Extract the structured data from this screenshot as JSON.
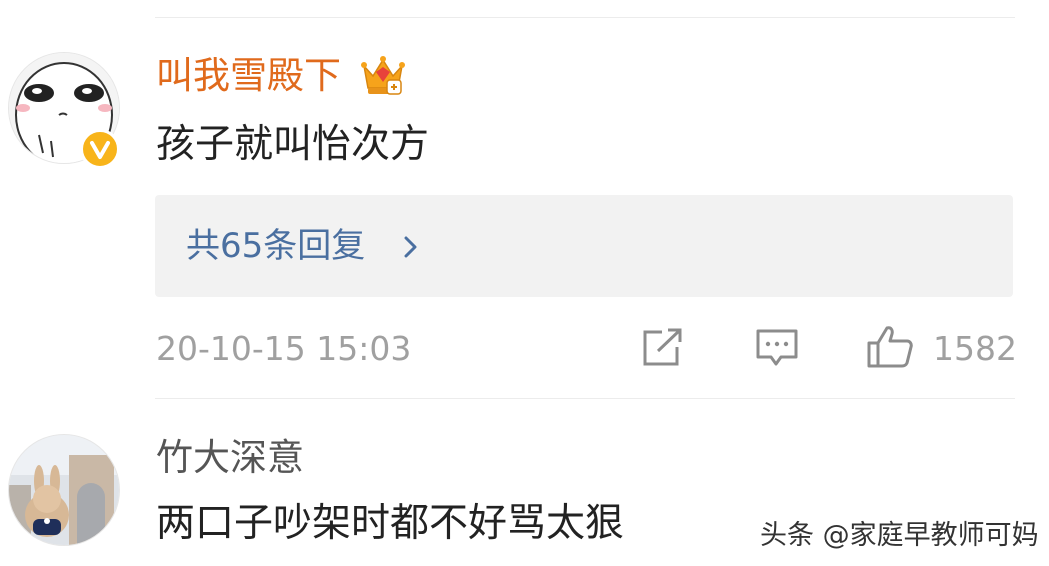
{
  "comments": [
    {
      "username": "叫我雪殿下",
      "text": "孩子就叫怡次方",
      "replies_label": "共65条回复",
      "timestamp": "20-10-15 15:03",
      "like_count": "1582"
    },
    {
      "username": "竹大深意",
      "text": "两口子吵架时都不好骂太狠"
    }
  ],
  "watermark": "头条 @家庭早教师可妈",
  "icons": {
    "crown": "crown-badge-icon",
    "verified": "verified-v-icon",
    "chevron": "chevron-right-icon",
    "share": "share-icon",
    "comment": "comment-icon",
    "like": "thumbs-up-icon"
  },
  "colors": {
    "username_vip": "#e06a1c",
    "username_normal": "#555555",
    "reply_link": "#4a6fa0",
    "meta_gray": "#a0a0a0",
    "verified_badge": "#f8b41a"
  }
}
